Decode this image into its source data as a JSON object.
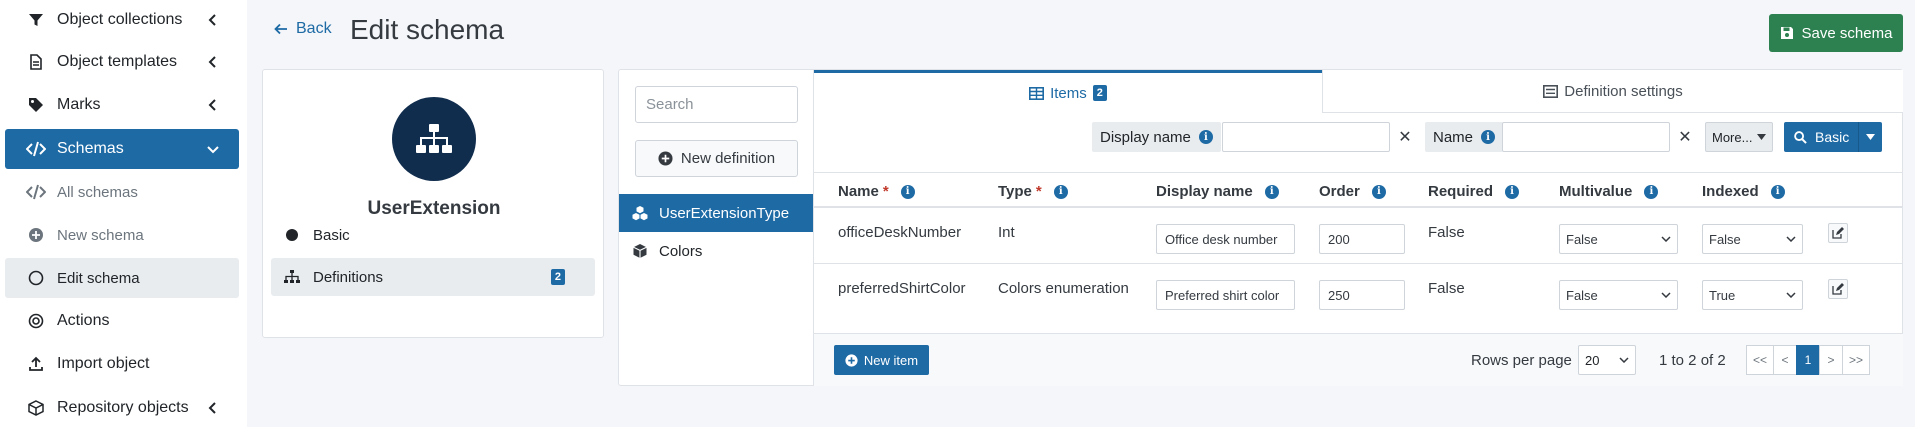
{
  "sidebar": {
    "items": [
      {
        "label": "Object collections"
      },
      {
        "label": "Object templates"
      },
      {
        "label": "Marks"
      },
      {
        "label": "Schemas"
      },
      {
        "label": "All schemas"
      },
      {
        "label": "New schema"
      },
      {
        "label": "Edit schema"
      },
      {
        "label": "Actions"
      },
      {
        "label": "Import object"
      },
      {
        "label": "Repository objects"
      }
    ]
  },
  "header": {
    "back_label": "Back",
    "title": "Edit schema",
    "save_label": "Save schema"
  },
  "schema_card": {
    "name": "UserExtension",
    "menu": [
      {
        "label": "Basic"
      },
      {
        "label": "Definitions",
        "badge": "2"
      }
    ]
  },
  "definitions": {
    "search_placeholder": "Search",
    "new_label": "New definition",
    "items": [
      {
        "label": "UserExtensionType"
      },
      {
        "label": "Colors"
      }
    ]
  },
  "tabs": {
    "items_label": "Items",
    "items_badge": "2",
    "settings_label": "Definition settings"
  },
  "filters": {
    "display_name_label": "Display name",
    "name_label": "Name",
    "clear": "✕",
    "more_label": "More...",
    "basic_label": "Basic"
  },
  "table": {
    "headers": {
      "name": "Name",
      "type": "Type",
      "display_name": "Display name",
      "order": "Order",
      "required": "Required",
      "multivalue": "Multivalue",
      "indexed": "Indexed"
    },
    "required_mark": "*",
    "rows": [
      {
        "name": "officeDeskNumber",
        "type": "Int",
        "display_name": "Office desk number",
        "order": "200",
        "required": "False",
        "multivalue": "False",
        "indexed": "False"
      },
      {
        "name": "preferredShirtColor",
        "type": "Colors enumeration",
        "display_name": "Preferred shirt color",
        "order": "250",
        "required": "False",
        "multivalue": "False",
        "indexed": "True"
      }
    ]
  },
  "footer": {
    "new_item_label": "New item",
    "rows_per_page_label": "Rows per page",
    "rows_per_page": "20",
    "range_text": "1 to 2 of 2",
    "pager": [
      "<<",
      "<",
      "1",
      ">",
      ">>"
    ]
  },
  "colors": {
    "primary": "#1d6aa5",
    "success": "#2d8050",
    "avatar": "#112d4e"
  }
}
